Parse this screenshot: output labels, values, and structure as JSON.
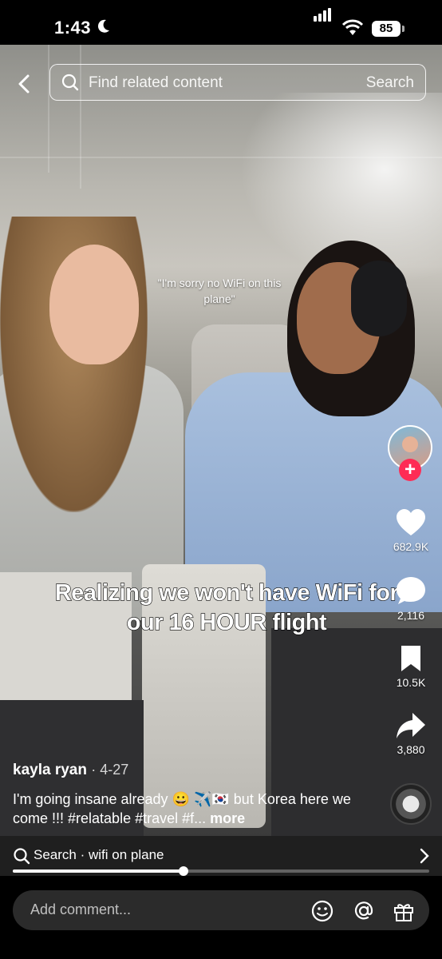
{
  "status_bar": {
    "time": "1:43",
    "battery": "85"
  },
  "search": {
    "placeholder": "Find related content",
    "button_label": "Search"
  },
  "video": {
    "quote": "\"I'm sorry no WiFi on this plane\"",
    "caption": "Realizing we won't have WiFi for our 16 HOUR flight"
  },
  "rail": {
    "likes": "682.9K",
    "comments": "2,116",
    "saves": "10.5K",
    "shares": "3,880"
  },
  "post": {
    "author": "kayla ryan",
    "date": "4-27",
    "description": "I'm going insane already 😀 ✈️🇰🇷 but Korea here we come !!! #relatable #travel #f...",
    "more": "more"
  },
  "bottom_search": {
    "label": "Search · wifi on plane"
  },
  "playback": {
    "progress": 0.41
  },
  "comment": {
    "placeholder": "Add comment..."
  },
  "colors": {
    "follow_accent": "#fe2c55"
  }
}
